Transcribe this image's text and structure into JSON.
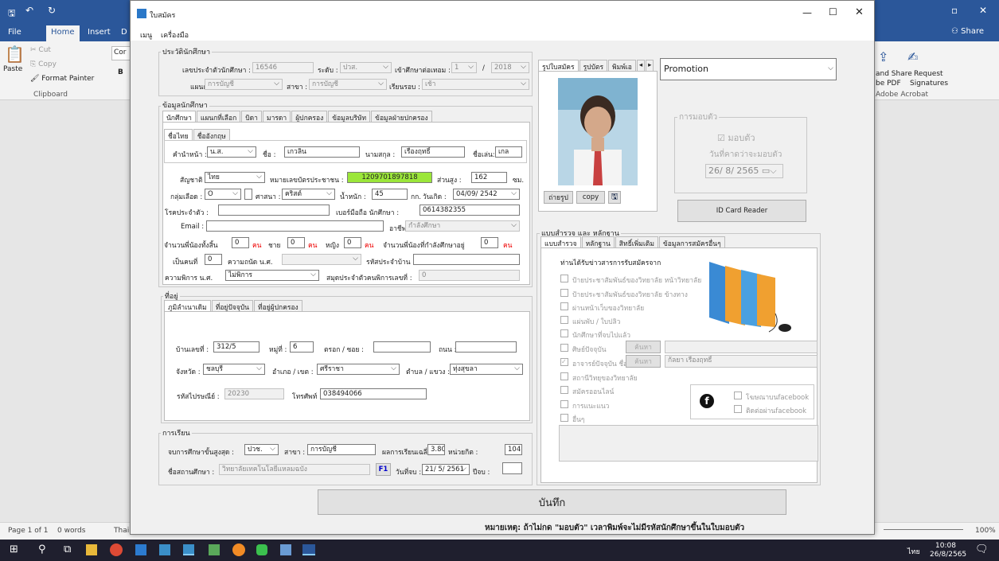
{
  "word": {
    "tabs": [
      "File",
      "Home",
      "Insert",
      "D"
    ],
    "share": "Share",
    "clipboard": {
      "paste": "Paste",
      "cut": "Cut",
      "copy": "Copy",
      "format_painter": "Format Painter",
      "group": "Clipboard"
    },
    "font_box": "Cor",
    "bold": "B",
    "adobe": {
      "share_pdf": "and Share",
      "pdf": "be PDF",
      "request": "Request",
      "signatures": "Signatures",
      "group": "Adobe Acrobat"
    },
    "status": {
      "page": "Page 1 of 1",
      "words": "0 words",
      "lang": "Thai",
      "zoom": "100%"
    }
  },
  "taskbar": {
    "ime": "ไทย",
    "time": "10:08",
    "date": "26/8/2565"
  },
  "dialog": {
    "title": "ใบสมัคร",
    "menu": [
      "เมนู",
      "เครื่องมือ"
    ],
    "history": {
      "group": "ประวัตินักศึกษา",
      "student_id_label": "เลขประจำตัวนักศึกษา :",
      "student_id": "16546",
      "level_label": "ระดับ :",
      "level": "ปวส.",
      "continue_label": "เข้าศึกษาต่อเทอม :",
      "term": "1",
      "year": "2018",
      "dept_label": "แผนก :",
      "dept": "การบัญชี",
      "major_label": "สาขา :",
      "major": "การบัญชี",
      "round_label": "เรียนรอบ :",
      "round": "เช้า"
    },
    "student": {
      "group": "ข้อมูลนักศึกษา",
      "tabs": [
        "นักศึกษา",
        "แผนกที่เลือก",
        "บิดา",
        "มารดา",
        "ผู้ปกครอง",
        "ข้อมูลบริษัท",
        "ข้อมูลฝ่ายปกครอง"
      ],
      "subtabs": [
        "ชื่อไทย",
        "ชื่ออังกฤษ"
      ],
      "prefix_label": "คำนำหน้า :",
      "prefix": "น.ส.",
      "name_label": "ชื่อ :",
      "name": "เกวลิน",
      "surname_label": "นามสกุล :",
      "surname": "เรืองฤทธิ์",
      "nick_label": "ชื่อเล่น:",
      "nick": "เกล",
      "nation_label": "สัญชาติ :",
      "nation": "ไทย",
      "idcard_label": "หมายเลขบัตรประชาชน :",
      "idcard": "1209701897818",
      "height_label": "ส่วนสูง :",
      "height": "162",
      "height_unit": "ซม.",
      "blood_label": "กลุ่มเลือด :",
      "blood": "O",
      "religion_label": "ศาสนา :",
      "religion": "คริสต์",
      "weight_label": "น้ำหนัก :",
      "weight": "45",
      "weight_unit": "กก.",
      "birth_label": "วันเกิด :",
      "birth": "04/09/ 2542",
      "disease_label": "โรคประจำตัว :",
      "mobile_label": "เบอร์มือถือ นักศึกษา :",
      "mobile": "0614382355",
      "email_label": "Email :",
      "job_label": "อาชีพ :",
      "job": "กำลังศึกษา",
      "sib_label": "จำนวนพี่น้องทั้งสิ้น",
      "sib": "0",
      "unit": "คน",
      "male_label": "ชาย",
      "male": "0",
      "female_label": "หญิง",
      "female": "0",
      "sib_study_label": "จำนวนพี่น้องที่กำลังศึกษาอยู่",
      "sib_study": "0",
      "child_label": "เป็นคนที่",
      "child": "0",
      "skill_label": "ความถนัด น.ศ.",
      "house_label": "รหัสประจำบ้าน :",
      "disabled_label": "ความพิการ น.ศ.",
      "disabled": "ไม่พิการ",
      "card_label": "สมุดประจำตัวคนพิการเลขที่ :",
      "card": "0"
    },
    "address": {
      "group": "ที่อยู่",
      "tabs": [
        "ภูมิลำเนาเดิม",
        "ที่อยู่ปัจจุบัน",
        "ที่อยู่ผู้ปกครอง"
      ],
      "house_label": "บ้านเลขที่ :",
      "house": "312/5",
      "moo_label": "หมู่ที่ :",
      "moo": "6",
      "alley_label": "ตรอก / ซอย :",
      "road_label": "ถนน :",
      "prov_label": "จังหวัด :",
      "prov": "ชลบุรี",
      "amphoe_label": "อำเภอ / เขต :",
      "amphoe": "ศรีราชา",
      "tambon_label": "ตำบล / แขวง :",
      "tambon": "ทุ่งสุขลา",
      "zip_label": "รหัสไปรษณีย์ :",
      "zip": "20230",
      "phone_label": "โทรศัพท์ :",
      "phone": "038494066"
    },
    "edu": {
      "group": "การเรียน",
      "grad_label": "จบการศึกษาขั้นสูงสุด :",
      "grad": "ปวช.",
      "major_label": "สาขา :",
      "major": "การบัญชี",
      "gpa_label": "ผลการเรียนเฉลี่ย :",
      "gpa": "3.80",
      "credit_label": "หน่วยกิต :",
      "credit": "104",
      "school_label": "ชื่อสถานศึกษา :",
      "school": "วิทยาลัยเทคโนโลยีแหลมฉบัง",
      "f1": "F1",
      "end_label": "วันที่จบ :",
      "end": "21/ 5/ 2561",
      "gen_label": "ปีจบ :"
    },
    "photo": {
      "tabs": [
        "รูปใบสมัคร",
        "รูปบัตร",
        "พิมพ์เอ"
      ],
      "take": "ถ่ายรูป",
      "copy": "copy"
    },
    "promo": "Promotion",
    "report": {
      "group": "การมอบตัว",
      "check": "มอบตัว",
      "expected": "วันที่คาดว่าจะมอบตัว",
      "date": "26/ 8/ 2565"
    },
    "idcard_btn": "ID Card Reader",
    "survey": {
      "group": "แบบสำรวจ และ หลักฐาน",
      "tabs": [
        "แบบสำรวจ",
        "หลักฐาน",
        "สิทธิ์เพิ่มเติม",
        "ข้อมูลการสมัครอื่นๆ"
      ],
      "question": "ท่านได้รับข่าวสารการรับสมัครจาก",
      "options": [
        "ป้ายประชาสัมพันธ์ของวิทยาลัย หน้าวิทยาลัย",
        "ป้ายประชาสัมพันธ์ของวิทยาลัย ข้างทาง",
        "ผ่านหน้าเว็บของวิทยาลัย",
        "แผ่นพับ / ใบปลิว",
        "นักศึกษาที่จบไปแล้ว",
        "ศิษย์ปัจจุบัน",
        "อาจารย์ปัจจุบัน ชื่อ",
        "สถานีวิทยุของวิทยาลัย",
        "สมัครออนไลน์",
        "การแนะแนว",
        "อื่นๆ"
      ],
      "search": "ค้นหา",
      "teacher": "ก้ลยา เรืองฤทธิ์",
      "fb": [
        "โฆษณาบนfacebook",
        "ติดต่อผ่านfacebook"
      ]
    },
    "save": "บันทึก",
    "note": "หมายเหตุ: ถ้าไม่กด \"มอบตัว\" เวลาพิมพ์จะไม่มีรหัสนักศึกษาขึ้นในใบมอบตัว"
  }
}
